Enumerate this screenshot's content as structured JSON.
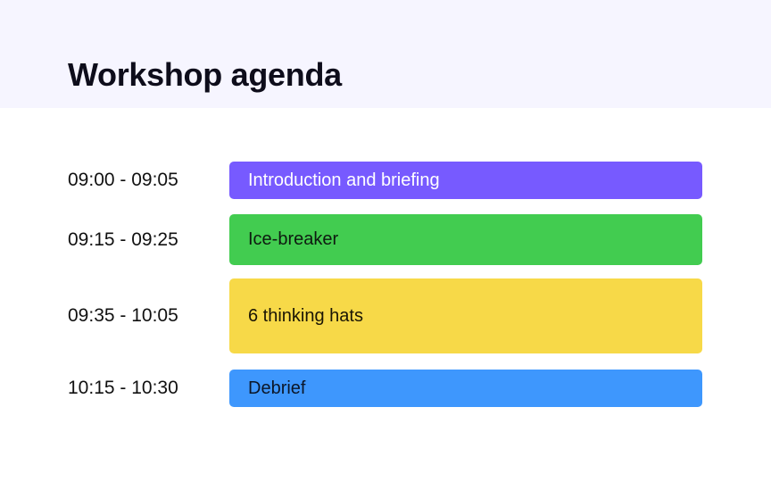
{
  "page": {
    "title": "Workshop agenda"
  },
  "agenda": {
    "items": [
      {
        "time": "09:00 - 09:05",
        "label": "Introduction and briefing",
        "color": "#775aff",
        "text_color": "#ffffff"
      },
      {
        "time": "09:15 - 09:25",
        "label": "Ice-breaker",
        "color": "#42cc50",
        "text_color": "#0e1a10"
      },
      {
        "time": "09:35 - 10:05",
        "label": "6 thinking hats",
        "color": "#f7d948",
        "text_color": "#1a1505"
      },
      {
        "time": "10:15 - 10:30",
        "label": "Debrief",
        "color": "#3e97fd",
        "text_color": "#0b1628"
      }
    ]
  }
}
